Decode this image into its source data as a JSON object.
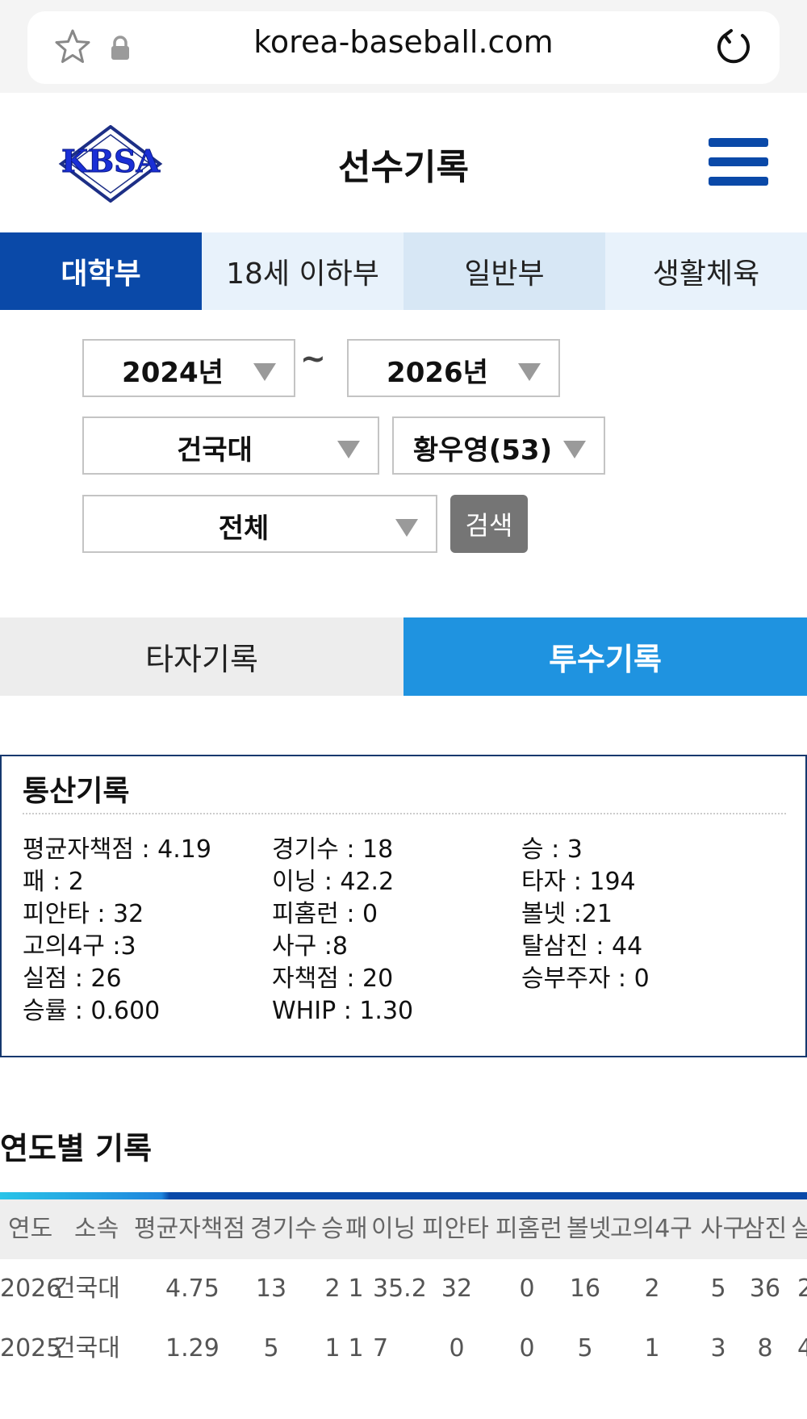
{
  "browser": {
    "url": "korea-baseball.com"
  },
  "header": {
    "logo_text": "KBSA",
    "title": "선수기록"
  },
  "division_tabs": [
    "대학부",
    "18세 이하부",
    "일반부",
    "생활체육"
  ],
  "filters": {
    "year_from": "2024년",
    "range_sep": "~",
    "year_to": "2026년",
    "team": "건국대",
    "player": "황우영(53)",
    "scope": "전체",
    "search_label": "검색"
  },
  "record_tabs": {
    "batting": "타자기록",
    "pitching": "투수기록"
  },
  "career": {
    "title": "통산기록",
    "stats": [
      [
        "평균자책점 : 4.19",
        "경기수 : 18",
        "승 : 3"
      ],
      [
        "패 : 2",
        "이닝 : 42.2",
        "타자 : 194"
      ],
      [
        "피안타 : 32",
        "피홈런 : 0",
        "볼넷 :21"
      ],
      [
        "고의4구 :3",
        "사구 :8",
        "탈삼진 : 44"
      ],
      [
        "실점 : 26",
        "자책점 : 20",
        "승부주자 : 0"
      ],
      [
        "승률 : 0.600",
        "WHIP : 1.30",
        ""
      ]
    ]
  },
  "yearly": {
    "title": "연도별 기록",
    "headers": [
      "연도",
      "소속",
      "평균자책점",
      "경기수",
      "승",
      "패",
      "이닝",
      "피안타",
      "피홈런",
      "볼넷",
      "고의4구",
      "사구",
      "삼진",
      "실"
    ],
    "rows": [
      [
        "2026",
        "건국대",
        "4.75",
        "13",
        "2",
        "1",
        "35.2",
        "32",
        "0",
        "16",
        "2",
        "5",
        "36",
        "2"
      ],
      [
        "2025",
        "건국대",
        "1.29",
        "5",
        "1",
        "1",
        "7",
        "0",
        "0",
        "5",
        "1",
        "3",
        "8",
        "4"
      ]
    ]
  }
}
